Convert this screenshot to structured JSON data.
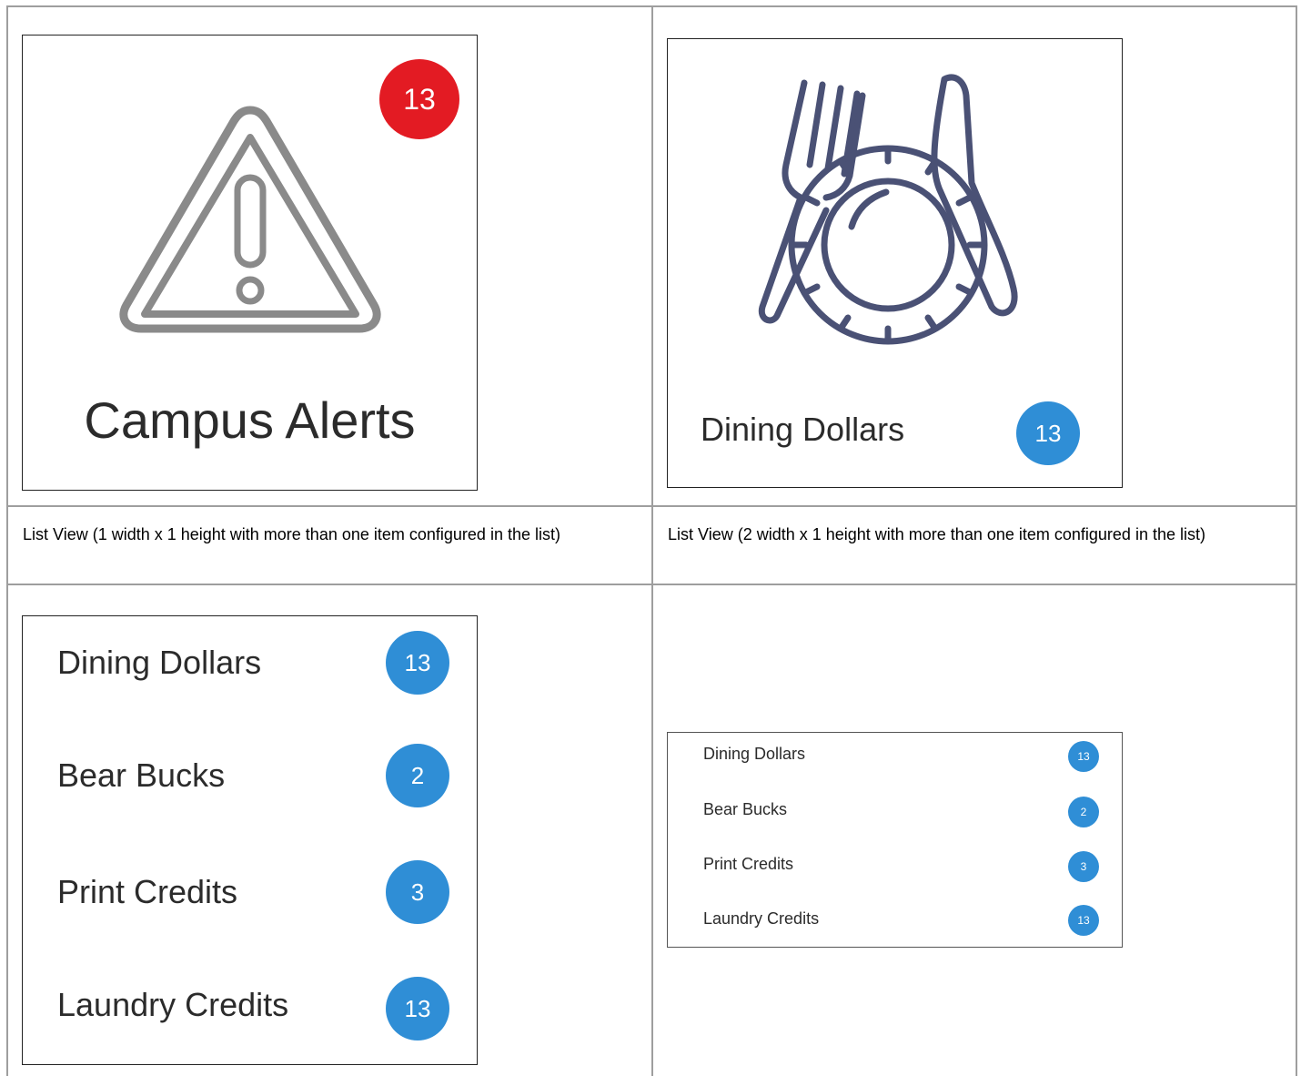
{
  "colors": {
    "accent_blue": "#2f8ed6",
    "alert_red": "#e31b23",
    "icon_gray": "#8a8a8a",
    "icon_navy": "#4a5175"
  },
  "campus_alerts": {
    "label": "Campus Alerts",
    "badge": "13",
    "icon": "warning-triangle-icon"
  },
  "dining_dollars": {
    "label": "Dining Dollars",
    "badge": "13",
    "icon": "fork-plate-knife-icon"
  },
  "captions": {
    "left": "List View (1 width x 1 height with more than one item configured in the list)",
    "right": "List View (2 width x 1 height with more than one item configured in the list)"
  },
  "list_items": [
    {
      "label": "Dining Dollars",
      "badge": "13"
    },
    {
      "label": "Bear Bucks",
      "badge": "2"
    },
    {
      "label": "Print Credits",
      "badge": "3"
    },
    {
      "label": "Laundry Credits",
      "badge": "13"
    }
  ]
}
